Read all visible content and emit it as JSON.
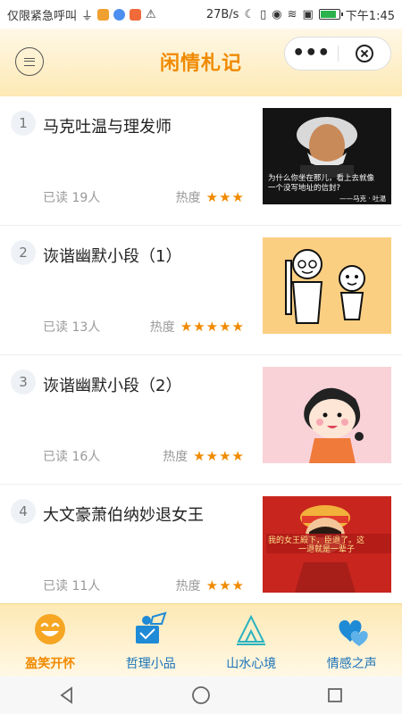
{
  "status_bar": {
    "left_text": "仅限紧急呼叫",
    "speed": "27B/s",
    "time": "下午1:45",
    "icons": [
      "usb-icon",
      "app-notification-icon",
      "music-icon",
      "video-icon",
      "warning-icon",
      "moon-icon",
      "vibrate-icon",
      "eye-icon",
      "wifi-icon",
      "sim-icon",
      "battery-icon"
    ]
  },
  "header": {
    "title": "闲情札记",
    "more_label": "•••"
  },
  "articles": [
    {
      "number": "1",
      "title": "马克吐温与理发师",
      "read": "已读 19人",
      "heat_label": "热度",
      "stars": "★★★",
      "heat_level": 3,
      "image_caption_line1": "为什么你坐在那儿，看上去就像",
      "image_caption_line2": "一个没写地址的信封?",
      "image_caption_line3": "——马克 · 吐温"
    },
    {
      "number": "2",
      "title": "诙谐幽默小段（1）",
      "read": "已读 13人",
      "heat_label": "热度",
      "stars": "★★★★★",
      "heat_level": 5
    },
    {
      "number": "3",
      "title": "诙谐幽默小段（2）",
      "read": "已读 16人",
      "heat_label": "热度",
      "stars": "★★★★",
      "heat_level": 4
    },
    {
      "number": "4",
      "title": "大文豪萧伯纳妙退女王",
      "read": "已读 11人",
      "heat_label": "热度",
      "stars": "★★★",
      "heat_level": 3,
      "image_caption_line1": "我的女王殿下，臣退了。这",
      "image_caption_line2": "一退就是一辈子"
    }
  ],
  "tabs": [
    {
      "label": "盈笑开怀",
      "icon": "smile-icon",
      "active": true
    },
    {
      "label": "哲理小品",
      "icon": "reading-person-icon",
      "active": false
    },
    {
      "label": "山水心境",
      "icon": "mountain-icon",
      "active": false
    },
    {
      "label": "情感之声",
      "icon": "hearts-icon",
      "active": false
    }
  ],
  "colors": {
    "accent": "#f08a00",
    "tab_inactive": "#1a73b8",
    "header_bg": "#fde9b5"
  }
}
